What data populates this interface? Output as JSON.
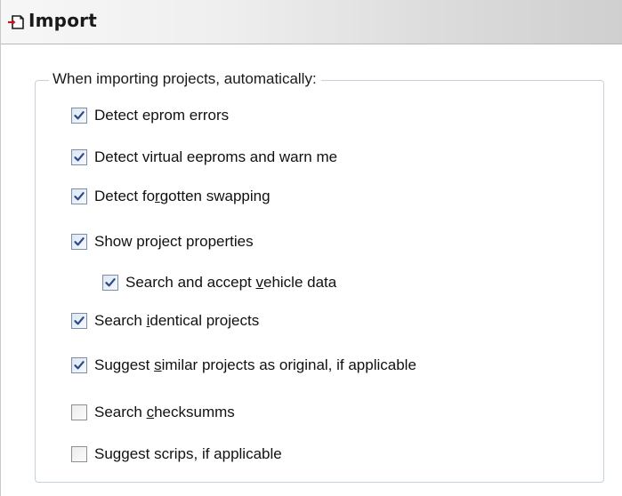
{
  "header": {
    "title": "Import",
    "icon": "import-arrow-icon"
  },
  "group": {
    "legend": "When importing projects, automatically:"
  },
  "options": [
    {
      "id": "detect-eprom-errors",
      "label": "Detect eprom errors",
      "checked": true
    },
    {
      "id": "detect-virtual-eeproms",
      "label": "Detect virtual eeproms and warn me",
      "checked": true
    },
    {
      "id": "detect-forgotten-swapping",
      "label_pre": "Detect fo",
      "label_acc": "r",
      "label_post": "gotten swapping",
      "checked": true
    },
    {
      "id": "show-project-properties",
      "label": "Show project properties",
      "checked": true
    },
    {
      "id": "search-accept-vehicle-data",
      "label_pre": "Search and accept ",
      "label_acc": "v",
      "label_post": "ehicle data",
      "checked": true
    },
    {
      "id": "search-identical-projects",
      "label_pre": "Search ",
      "label_acc": "i",
      "label_post": "dentical projects",
      "checked": true
    },
    {
      "id": "suggest-similar-projects",
      "label_pre": "Suggest ",
      "label_acc": "s",
      "label_post": "imilar projects as original, if applicable",
      "checked": true
    },
    {
      "id": "search-checksumms",
      "label_pre": "Search ",
      "label_acc": "c",
      "label_post": "hecksumms",
      "checked": false
    },
    {
      "id": "suggest-scrips",
      "label": "Suggest scrips, if applicable",
      "checked": false
    }
  ],
  "colors": {
    "check_mark": "#2b4a86",
    "group_border": "#c5d2dd"
  }
}
